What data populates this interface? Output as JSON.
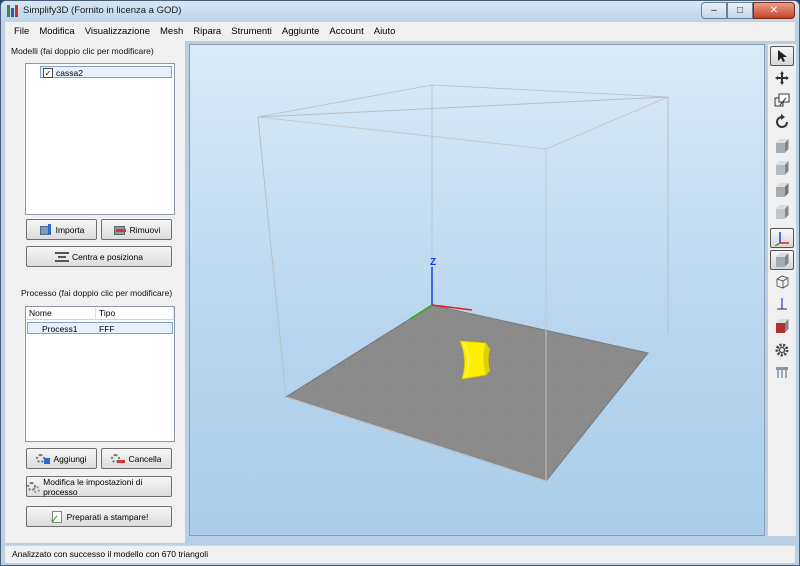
{
  "window": {
    "title": "Simplify3D (Fornito in licenza a GOD)"
  },
  "menu": [
    "File",
    "Modifica",
    "Visualizzazione",
    "Mesh",
    "Ripara",
    "Strumenti",
    "Aggiunte",
    "Account",
    "Aiuto"
  ],
  "models": {
    "title": "Modelli (fai doppio clic per modificare)",
    "items": [
      {
        "name": "cassa2",
        "checked": true
      }
    ],
    "buttons": {
      "import": "Importa",
      "remove": "Rimuovi",
      "center": "Centra e posiziona"
    }
  },
  "processes": {
    "title": "Processo (fai doppio clic per modificare)",
    "columns": [
      "Nome",
      "Tipo"
    ],
    "rows": [
      {
        "name": "Process1",
        "type": "FFF"
      }
    ],
    "buttons": {
      "add": "Aggiungi",
      "delete": "Cancella",
      "edit": "Modifica le impostazioni di processo",
      "print": "Preparati a stampare!"
    }
  },
  "viewport": {
    "axis_label": "Z",
    "model_color": "#ffee00",
    "bed_color": "#8a8a8a"
  },
  "toolbar": [
    "select-icon",
    "move-icon",
    "scale-icon",
    "rotate-icon",
    "cube-view-icon",
    "cube-view-icon",
    "cube-view-icon",
    "cube-view-icon",
    "axes-icon",
    "shaded-cube-icon",
    "wireframe-cube-icon",
    "normals-icon",
    "cross-section-icon",
    "gear-icon",
    "supports-icon"
  ],
  "status": {
    "text": "Analizzato con successo il modello con 670 triangoli"
  }
}
